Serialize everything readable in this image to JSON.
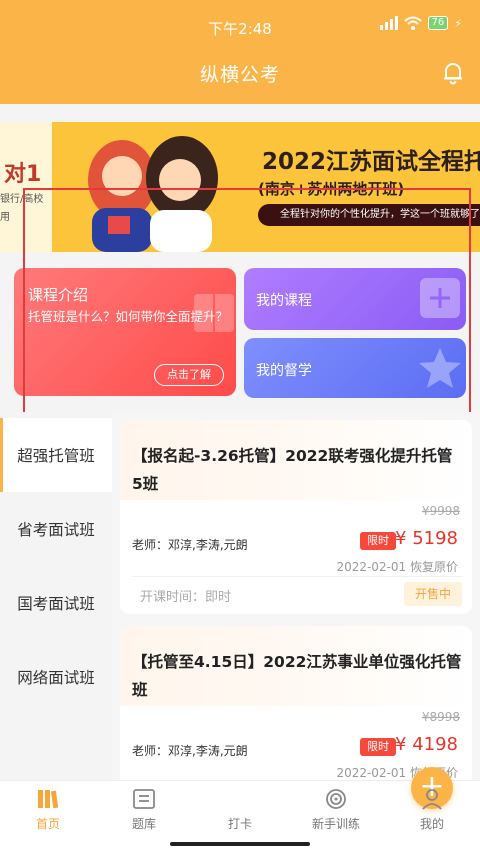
{
  "status_bar": {
    "time": "下午2:48",
    "battery": "76"
  },
  "header": {
    "title": "纵横公考"
  },
  "banner": {
    "left_text": "对1",
    "left_sub1": "银行/高校",
    "left_sub2": "用",
    "title": "2022江苏面试全程托",
    "subtitle": "(南京+苏州两地开班)",
    "pill": "全程针对你的个性化提升，学这一个班就够了"
  },
  "cards": {
    "intro_title": "课程介绍",
    "intro_desc": "托管班是什么？如何带你全面提升？",
    "intro_button": "点击了解",
    "my_courses": "我的课程",
    "my_study": "我的督学"
  },
  "sidebar": {
    "items": [
      {
        "label": "超强托管班"
      },
      {
        "label": "省考面试班"
      },
      {
        "label": "国考面试班"
      },
      {
        "label": "网络面试班"
      }
    ]
  },
  "courses": [
    {
      "title": "【报名起-3.26托管】2022联考强化提升托管5班",
      "original_price": "¥9998",
      "teacher": "老师：邓淳,李涛,元朗",
      "tag": "限时",
      "price": "¥ 5198",
      "date": "2022-02-01  恢复原价",
      "open_time": "开课时间：即时",
      "status": "开售中"
    },
    {
      "title": "【托管至4.15日】2022江苏事业单位强化托管班",
      "original_price": "¥8998",
      "teacher": "老师：邓淳,李涛,元朗",
      "tag": "限时",
      "price": "¥ 4198",
      "date": "2022-02-01  恢复原价"
    }
  ],
  "tabbar": {
    "items": [
      {
        "label": "首页",
        "icon": "home-books-icon"
      },
      {
        "label": "题库",
        "icon": "question-bank-icon"
      },
      {
        "label": "打卡",
        "icon": "plus-icon"
      },
      {
        "label": "新手训练",
        "icon": "target-icon"
      },
      {
        "label": "我的",
        "icon": "user-icon"
      }
    ]
  },
  "colors": {
    "accent": "#fbb447",
    "price_red": "#e8352a",
    "tag_red": "#f7483c"
  }
}
